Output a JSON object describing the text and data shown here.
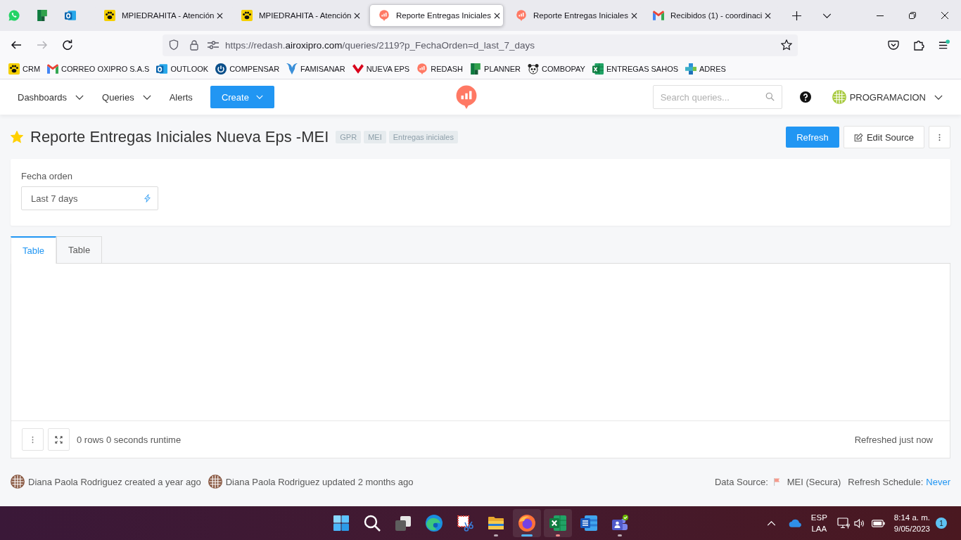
{
  "browser": {
    "tabs": [
      {
        "kind": "paw",
        "title": "MPIEDRAHITA - Atención",
        "selected": false
      },
      {
        "kind": "paw",
        "title": "MPIEDRAHITA - Atención",
        "selected": false
      },
      {
        "kind": "bubble",
        "title": "Reporte Entregas Iniciales",
        "selected": true
      },
      {
        "kind": "bubble",
        "title": "Reporte Entregas Iniciales",
        "selected": false
      },
      {
        "kind": "mail",
        "title": "Recibidos (1) - coordinaci",
        "selected": false
      }
    ],
    "back_button": {
      "disabled": false
    },
    "forward_button": {
      "disabled": true
    },
    "address": {
      "prefix": "https://redash.",
      "domain": "airoxipro.com",
      "path": "/queries/2119?p_FechaOrden=d_last_7_days"
    },
    "app_menu": {
      "update_badge": true
    },
    "bookmarks": [
      {
        "kind": "paw",
        "label": "CRM"
      },
      {
        "kind": "mail",
        "label": "CORREO OXIPRO S.A.S"
      },
      {
        "kind": "tile",
        "label": "OUTLOOK"
      },
      {
        "kind": "power",
        "label": "COMPENSAR"
      },
      {
        "kind": "wing",
        "label": "FAMISANAR"
      },
      {
        "kind": "vee",
        "label": "NUEVA EPS"
      },
      {
        "kind": "bubble",
        "label": "REDASH"
      },
      {
        "kind": "squares",
        "label": "PLANNER"
      },
      {
        "kind": "panda",
        "label": "COMBOPAY"
      },
      {
        "kind": "sheet",
        "label": "ENTREGAS SAHOS"
      },
      {
        "kind": "cross",
        "label": "ADRES"
      }
    ]
  },
  "header": {
    "nav": [
      {
        "label": "Dashboards",
        "dropdown": true
      },
      {
        "label": "Queries",
        "dropdown": true
      },
      {
        "label": "Alerts",
        "dropdown": false
      }
    ],
    "create_button": "Create",
    "search": {
      "placeholder": "Search queries..."
    },
    "user": "PROGRAMACION"
  },
  "query": {
    "favorite": true,
    "title": "Reporte Entregas Iniciales Nueva Eps -MEI",
    "tags": [
      "GPR",
      "MEI",
      "Entregas iniciales"
    ],
    "refresh_button": "Refresh",
    "edit_button": "Edit Source"
  },
  "parameters": [
    {
      "label": "Fecha orden",
      "value": "Last 7 days"
    }
  ],
  "visualization_tabs": [
    {
      "label": "Table",
      "selected": true
    },
    {
      "label": "Table",
      "selected": false
    }
  ],
  "results": {
    "summary": "0 rows 0 seconds runtime",
    "refreshed": "Refreshed just now"
  },
  "footer": {
    "history": [
      "Diana Paola Rodriguez created a year ago",
      "Diana Paola Rodriguez updated 2 months ago"
    ],
    "data_source_label": "Data Source:",
    "data_source": "MEI (Secura)",
    "schedule_label": "Refresh Schedule:",
    "schedule": "Never"
  },
  "taskbar": {
    "apps": [
      {
        "kind": "start",
        "open": false,
        "active": false,
        "attention": false
      },
      {
        "kind": "search",
        "open": false,
        "active": false,
        "attention": false
      },
      {
        "kind": "views",
        "open": false,
        "active": false,
        "attention": false
      },
      {
        "kind": "swirl",
        "open": false,
        "active": false,
        "attention": false
      },
      {
        "kind": "snip",
        "open": false,
        "active": false,
        "attention": false
      },
      {
        "kind": "folder",
        "open": true,
        "active": false,
        "attention": false
      },
      {
        "kind": "globe",
        "open": true,
        "active": true,
        "attention": false
      },
      {
        "kind": "sheet",
        "open": true,
        "active": false,
        "attention": true
      },
      {
        "kind": "doc",
        "open": false,
        "active": false,
        "attention": false
      },
      {
        "kind": "people",
        "open": true,
        "active": false,
        "attention": false
      }
    ],
    "language": "ESP",
    "layout": "LAA",
    "time": "8:14 a. m.",
    "date": "9/05/2023",
    "notifications": "1"
  }
}
